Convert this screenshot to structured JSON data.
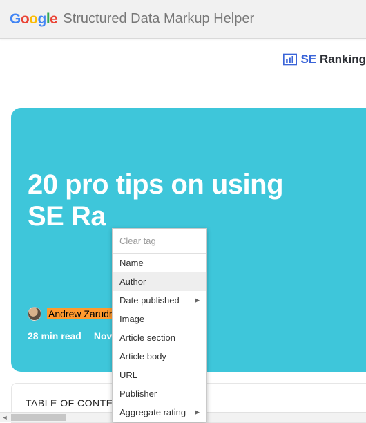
{
  "header": {
    "logo_letters": {
      "g1": "G",
      "g2": "o",
      "g3": "o",
      "g4": "g",
      "g5": "l",
      "g6": "e"
    },
    "title": "Structured Data Markup Helper"
  },
  "brand": {
    "se": "SE",
    "ranking": "Ranking"
  },
  "hero": {
    "title_line1": "20 pro tips on using",
    "title_line2": "SE Ra",
    "author": "Andrew Zarudnyi",
    "read_time": "28 min read",
    "date": "Nov"
  },
  "toc": {
    "label": "TABLE OF CONTENTS"
  },
  "menu": {
    "clear": "Clear tag",
    "items": [
      {
        "label": "Name",
        "submenu": false
      },
      {
        "label": "Author",
        "submenu": false,
        "hover": true
      },
      {
        "label": "Date published",
        "submenu": true
      },
      {
        "label": "Image",
        "submenu": false
      },
      {
        "label": "Article section",
        "submenu": false
      },
      {
        "label": "Article body",
        "submenu": false
      },
      {
        "label": "URL",
        "submenu": false
      },
      {
        "label": "Publisher",
        "submenu": false
      },
      {
        "label": "Aggregate rating",
        "submenu": true
      }
    ]
  }
}
